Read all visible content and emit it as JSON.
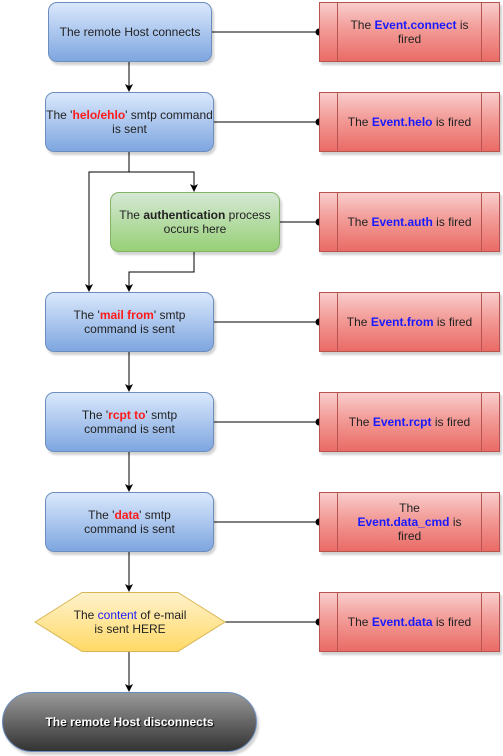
{
  "colors": {
    "process_fill": "#dae8fc",
    "auth_fill": "#d5e8d4",
    "event_fill": "#f8cecc",
    "content_fill": "#fff2cc",
    "terminal_fill": "#555555",
    "command_highlight": "#ff1a1a",
    "event_highlight": "#1a1aff"
  },
  "flow": {
    "connect": [
      {
        "t": "The remote Host connects",
        "s": ""
      }
    ],
    "helo": [
      {
        "t": "The '",
        "s": ""
      },
      {
        "t": "helo/ehlo",
        "s": "kw-red"
      },
      {
        "t": "' smtp command is sent",
        "s": ""
      }
    ],
    "auth": [
      {
        "t": "The  ",
        "s": ""
      },
      {
        "t": "authentication",
        "s": "kw-bold"
      },
      {
        "t": " process occurs here",
        "s": ""
      }
    ],
    "mail": [
      {
        "t": "The '",
        "s": ""
      },
      {
        "t": "mail from",
        "s": "kw-red"
      },
      {
        "t": "' smtp command is sent",
        "s": ""
      }
    ],
    "rcpt": [
      {
        "t": "The '",
        "s": ""
      },
      {
        "t": "rcpt to",
        "s": "kw-red"
      },
      {
        "t": "' smtp command is sent",
        "s": ""
      }
    ],
    "data": [
      {
        "t": "The '",
        "s": ""
      },
      {
        "t": "data",
        "s": "kw-red"
      },
      {
        "t": "' smtp command is sent",
        "s": ""
      }
    ],
    "content": [
      {
        "t": "The ",
        "s": ""
      },
      {
        "t": "content",
        "s": "kw-blue-plain"
      },
      {
        "t": " of e-mail is sent HERE",
        "s": ""
      }
    ],
    "disconnect": [
      {
        "t": "The remote Host disconnects",
        "s": ""
      }
    ]
  },
  "events": {
    "connect": [
      {
        "t": "The ",
        "s": ""
      },
      {
        "t": "Event.connect",
        "s": "kw-blue"
      },
      {
        "t": " is fired",
        "s": ""
      }
    ],
    "helo": [
      {
        "t": "The ",
        "s": ""
      },
      {
        "t": "Event.helo",
        "s": "kw-blue"
      },
      {
        "t": " is fired",
        "s": ""
      }
    ],
    "auth": [
      {
        "t": "The ",
        "s": ""
      },
      {
        "t": "Event.auth",
        "s": "kw-blue"
      },
      {
        "t": " is fired",
        "s": ""
      }
    ],
    "from": [
      {
        "t": "The ",
        "s": ""
      },
      {
        "t": "Event.from",
        "s": "kw-blue"
      },
      {
        "t": " is fired",
        "s": ""
      }
    ],
    "rcpt": [
      {
        "t": "The ",
        "s": ""
      },
      {
        "t": "Event.rcpt",
        "s": "kw-blue"
      },
      {
        "t": " is fired",
        "s": ""
      }
    ],
    "data_cmd": [
      {
        "t": "The ",
        "s": ""
      },
      {
        "t": "Event.data_cmd",
        "s": "kw-blue"
      },
      {
        "t": " is fired",
        "s": ""
      }
    ],
    "data": [
      {
        "t": "The ",
        "s": ""
      },
      {
        "t": "Event.data",
        "s": "kw-blue"
      },
      {
        "t": " is fired",
        "s": ""
      }
    ]
  }
}
